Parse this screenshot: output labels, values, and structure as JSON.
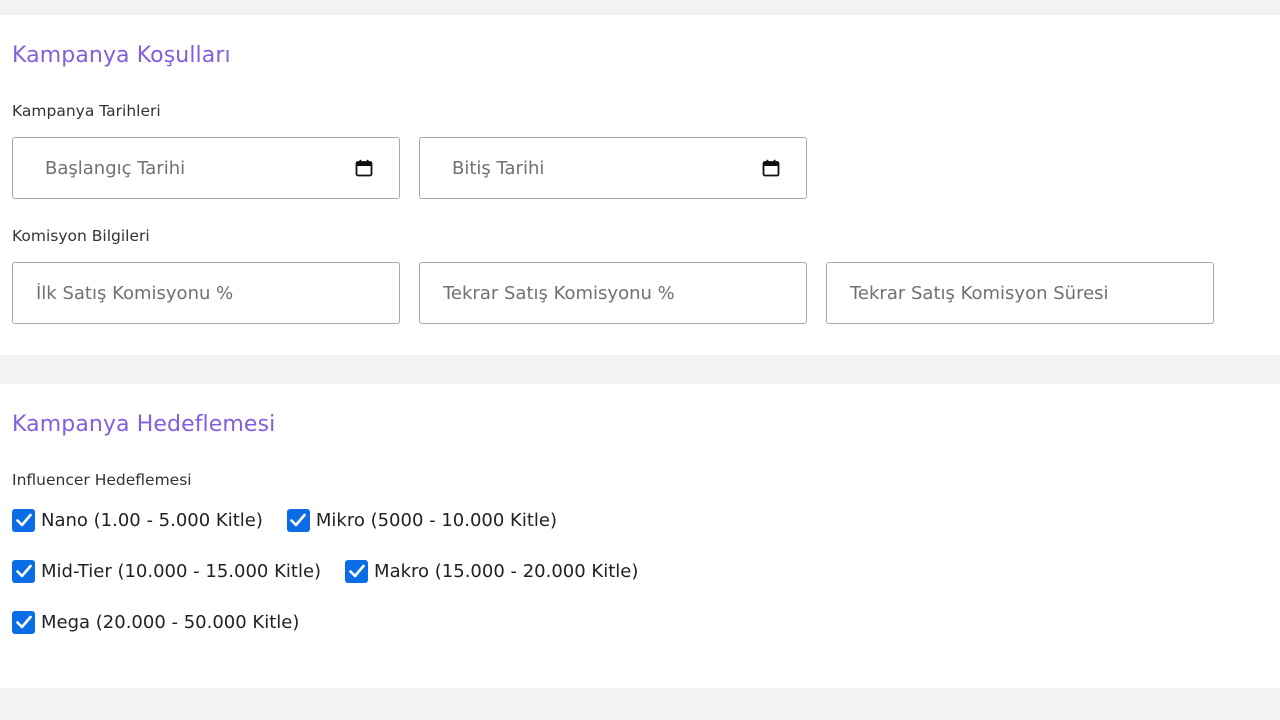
{
  "colors": {
    "accent": "#8060dc",
    "checkbox": "#0a6de6",
    "border": "#a9a9ad"
  },
  "campaign_conditions": {
    "title": "Kampanya Koşulları",
    "dates": {
      "label": "Kampanya Tarihleri",
      "start_placeholder": "Başlangıç Tarihi",
      "end_placeholder": "Bitiş Tarihi",
      "icon": "calendar-icon"
    },
    "commission": {
      "label": "Komisyon Bilgileri",
      "first_sale_placeholder": "İlk Satış Komisyonu %",
      "repeat_sale_placeholder": "Tekrar Satış Komisyonu %",
      "repeat_duration_placeholder": "Tekrar Satış Komisyon Süresi"
    }
  },
  "campaign_targeting": {
    "title": "Kampanya Hedeflemesi",
    "influencer": {
      "label": "Influencer Hedeflemesi",
      "options": [
        {
          "label": "Nano (1.00 - 5.000 Kitle)",
          "checked": true
        },
        {
          "label": "Mikro (5000 - 10.000 Kitle)",
          "checked": true
        },
        {
          "label": "Mid-Tier (10.000 - 15.000 Kitle)",
          "checked": true
        },
        {
          "label": "Makro (15.000 - 20.000 Kitle)",
          "checked": true
        },
        {
          "label": "Mega (20.000 - 50.000 Kitle)",
          "checked": true
        }
      ]
    }
  }
}
